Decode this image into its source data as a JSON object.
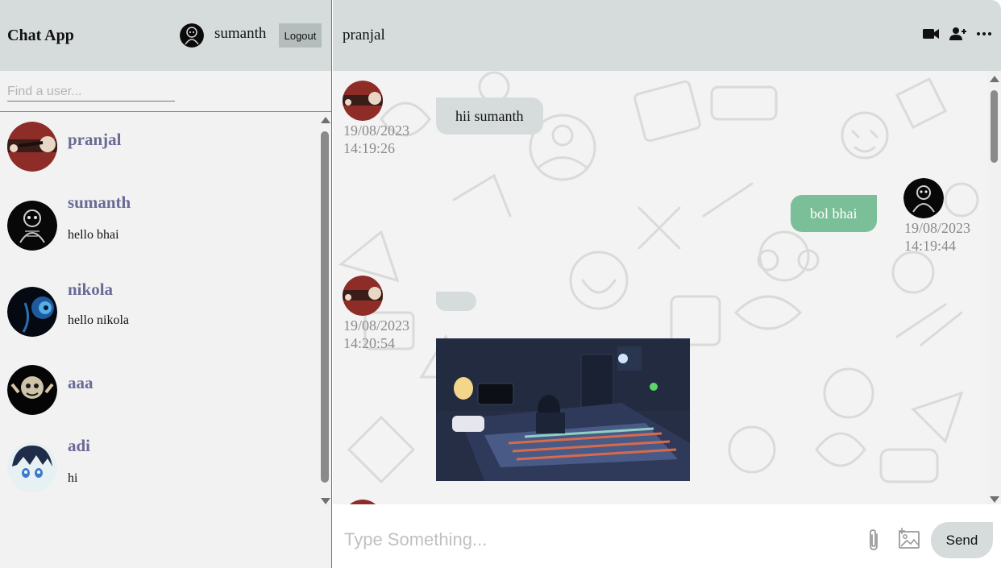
{
  "sidebar": {
    "app_title": "Chat App",
    "current_user": "sumanth",
    "logout_label": "Logout",
    "search_placeholder": "Find a user...",
    "users": [
      {
        "name": "pranjal",
        "last_message": ""
      },
      {
        "name": "sumanth",
        "last_message": "hello bhai"
      },
      {
        "name": "nikola",
        "last_message": "hello nikola"
      },
      {
        "name": "aaa",
        "last_message": ""
      },
      {
        "name": "adi",
        "last_message": "hi"
      }
    ]
  },
  "chat": {
    "peer_name": "pranjal",
    "header_icons": [
      "video-call-icon",
      "add-user-icon",
      "more-options-icon"
    ],
    "messages": [
      {
        "direction": "in",
        "text": "hii sumanth",
        "date": "19/08/2023",
        "time": "14:19:26"
      },
      {
        "direction": "out",
        "text": "bol bhai",
        "date": "19/08/2023",
        "time": "14:19:44"
      },
      {
        "direction": "in",
        "text": "",
        "date": "19/08/2023",
        "time": "14:20:54",
        "has_image": true
      }
    ],
    "composer": {
      "placeholder": "Type Something...",
      "send_label": "Send"
    }
  },
  "colors": {
    "header_bg": "#d6dcdc",
    "sidebar_bg": "#f2f2f2",
    "username_color": "#6a6a96",
    "outgoing_bubble": "#7bbf98",
    "incoming_bubble": "#d6dcdc"
  }
}
